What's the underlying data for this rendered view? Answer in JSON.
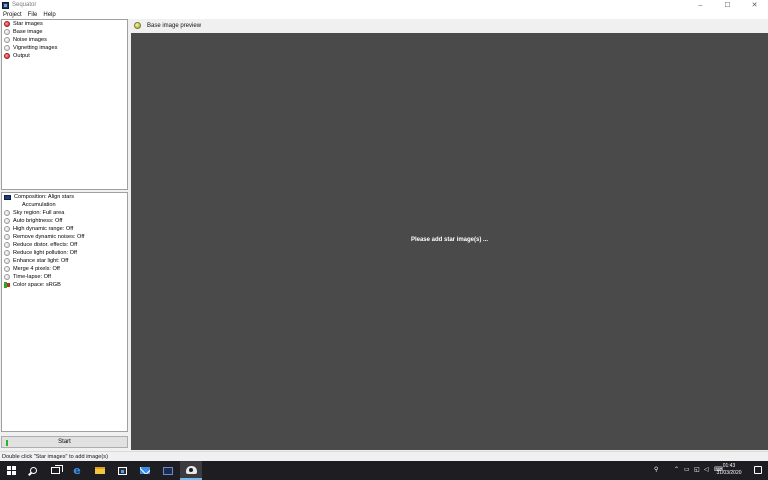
{
  "window": {
    "title": "Sequator",
    "controls": [
      "–",
      "☐",
      "✕"
    ]
  },
  "menu": [
    "Project",
    "File",
    "Help"
  ],
  "input_tree": [
    {
      "label": "Star images",
      "state": "red"
    },
    {
      "label": "Base image",
      "state": "gray"
    },
    {
      "label": "Noise images",
      "state": "gray"
    },
    {
      "label": "Vignetting images",
      "state": "gray"
    },
    {
      "label": "Output",
      "state": "red"
    }
  ],
  "settings": {
    "composition": "Composition: Align stars",
    "composition_sub": "Accumulation",
    "items": [
      "Sky region: Full area",
      "Auto brightness: Off",
      "High dynamic range: Off",
      "Remove dynamic noises: Off",
      "Reduce distor. effects: Off",
      "Reduce light pollution: Off",
      "Enhance star light: Off",
      "Merge 4 pixels: Off",
      "Time-lapse: Off"
    ],
    "color_space": "Color space: sRGB"
  },
  "start_button": "Start",
  "preview": {
    "title": "Base image preview",
    "message": "Please add star image(s) ...",
    "background": "#4a4a4a"
  },
  "status_bar": "Double click \"Star images\" to add image(s)",
  "taskbar": {
    "apps": [
      "windows-start",
      "search",
      "task-view",
      "edge",
      "file-explorer",
      "store",
      "mail",
      "monitor-app",
      "sequator"
    ],
    "time": "01:43",
    "date": "31/03/2020"
  }
}
